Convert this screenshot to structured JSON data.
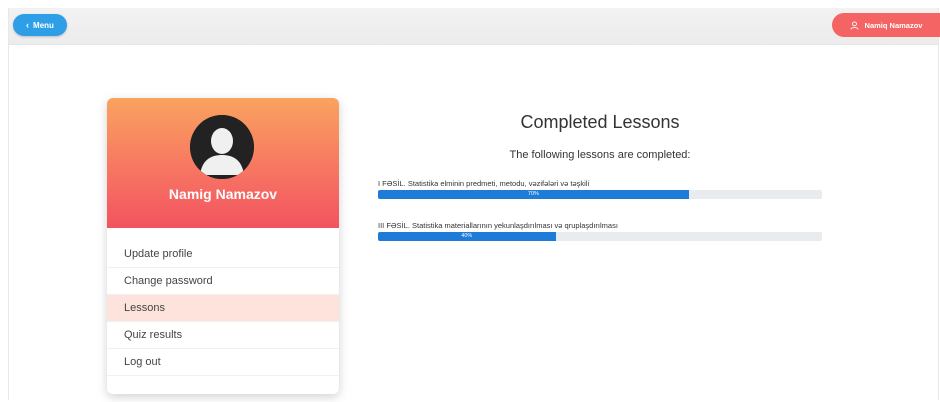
{
  "topbar": {
    "menu_label": "Menu",
    "user_label": "Namiq Namazov",
    "menu_color": "#2e9fe6",
    "user_color": "#f46464",
    "icons": {
      "back": "chevron-left-icon",
      "user": "user-icon"
    }
  },
  "profile": {
    "name": "Namig Namazov",
    "avatar_icon": "avatar-silhouette-icon",
    "header_gradient": [
      "#f9a35f",
      "#f2545f"
    ]
  },
  "sidebar": {
    "items": [
      {
        "label": "Update profile",
        "active": false
      },
      {
        "label": "Change password",
        "active": false
      },
      {
        "label": "Lessons",
        "active": true
      },
      {
        "label": "Quiz results",
        "active": false
      },
      {
        "label": "Log out",
        "active": false
      }
    ]
  },
  "main": {
    "title": "Completed Lessons",
    "subtitle": "The following lessons are completed:",
    "lessons": [
      {
        "title": "I FƏSİL. Statistika elminin predmeti, metodu, vəzifələri və təşkili",
        "progress": 0.7,
        "progress_label": "70%"
      },
      {
        "title": "III FƏSİL. Statistika materiallarının yekunlaşdırılması və qruplaşdırılması",
        "progress": 0.4,
        "progress_label": "40%"
      }
    ],
    "bar_color": "#1e7bd8"
  }
}
